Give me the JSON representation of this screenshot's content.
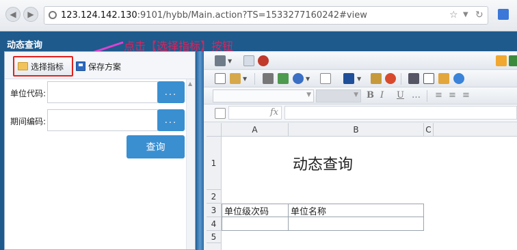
{
  "browser": {
    "url_host": "123.124.142.130",
    "url_path": ":9101/hybb/Main.action?TS=1533277160242#view",
    "back_icon": "back-arrow-icon",
    "forward_icon": "forward-arrow-icon"
  },
  "panel": {
    "title": "动态查询",
    "annotation": "点击【选择指标】按钮",
    "annotation_color": "#e0215b"
  },
  "left_toolbar": {
    "select_label": "选择指标",
    "save_label": "保存方案",
    "select_highlight_color": "#e3201b"
  },
  "form": {
    "unit_code_label": "单位代码:",
    "unit_code_value": "",
    "period_code_label": "期间编码:",
    "period_code_value": "",
    "picker_label": "...",
    "query_label": "查询",
    "button_color": "#3a8fd1"
  },
  "sheet": {
    "columns": [
      "A",
      "B",
      "C"
    ],
    "rows": [
      "1",
      "2",
      "3",
      "4",
      "5"
    ],
    "title": "动态查询",
    "headers": [
      "单位级次码",
      "单位名称"
    ]
  },
  "editor": {
    "formula_label": "fx"
  }
}
